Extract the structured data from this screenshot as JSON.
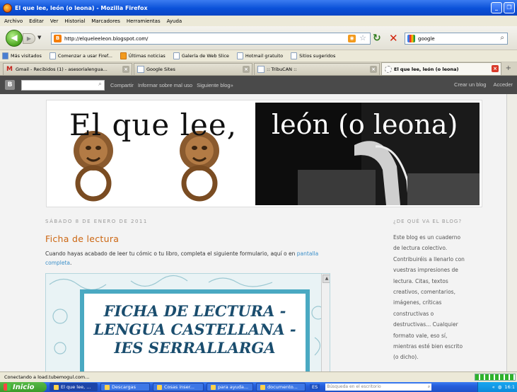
{
  "window": {
    "title": "El que lee, león (o leona) - Mozilla Firefox"
  },
  "menu": [
    "Archivo",
    "Editar",
    "Ver",
    "Historial",
    "Marcadores",
    "Herramientas",
    "Ayuda"
  ],
  "nav": {
    "url": "http://elqueleeleon.blogspot.com/",
    "search_value": "google"
  },
  "bookmarks": [
    "Más visitados",
    "Comenzar a usar Firef...",
    "Últimas noticias",
    "Galería de Web Slice",
    "Hotmail gratuito",
    "Sitios sugeridos"
  ],
  "tabs": [
    {
      "label": "Gmail - Recibidos (1) - asesorialengua...",
      "icon": "gmail-icon",
      "active": false
    },
    {
      "label": "Google Sites",
      "icon": "sites-icon",
      "active": false
    },
    {
      "label": ":: TribuCAN ::",
      "icon": "page-icon",
      "active": false
    },
    {
      "label": "El que lee, león (o leona)",
      "icon": "loading-icon",
      "active": true
    }
  ],
  "blogger_bar": {
    "share": "Compartir",
    "report": "Informar sobre mal uso",
    "next": "Siguiente blog»",
    "create": "Crear un blog",
    "login": "Acceder"
  },
  "header": {
    "title_left": "El que lee,",
    "title_right": "león (o leona)"
  },
  "post": {
    "date": "SÁBADO 8 DE ENERO DE 2011",
    "title": "Ficha de lectura",
    "body": "Cuando hayas acabado de leer tu cómic o tu libro, completa el siguiente formulario, aquí o en",
    "link": "pantalla completa",
    "link_suffix": "."
  },
  "embed": {
    "line1": "FICHA DE LECTURA -",
    "line2": "LENGUA CASTELLANA -",
    "line3": "IES SERRALLARGA"
  },
  "sidebar": {
    "title": "¿DE QUÉ VA EL BLOG?",
    "lines": [
      "Este blog es un cuaderno",
      "de lectura colectivo.",
      "Contribuiréis a llenarlo con",
      "vuestras impresiones de",
      "lectura. Citas, textos",
      "creativos, comentarios,",
      "imágenes, críticas",
      "constructivas o",
      "destructivas... Cualquier",
      "formato vale, eso sí,",
      "mientras esté bien escrito",
      "(o dicho)."
    ]
  },
  "status": {
    "text": "Conectando a load.tubemogul.com..."
  },
  "taskbar": {
    "start": "Inicio",
    "tasks": [
      "El que lee, ...",
      "Descargas",
      "Cosas inser...",
      "para ayuda...",
      "documento..."
    ],
    "lang": "ES",
    "search_placeholder": "Búsqueda en el escritorio",
    "clock": "16:1"
  }
}
